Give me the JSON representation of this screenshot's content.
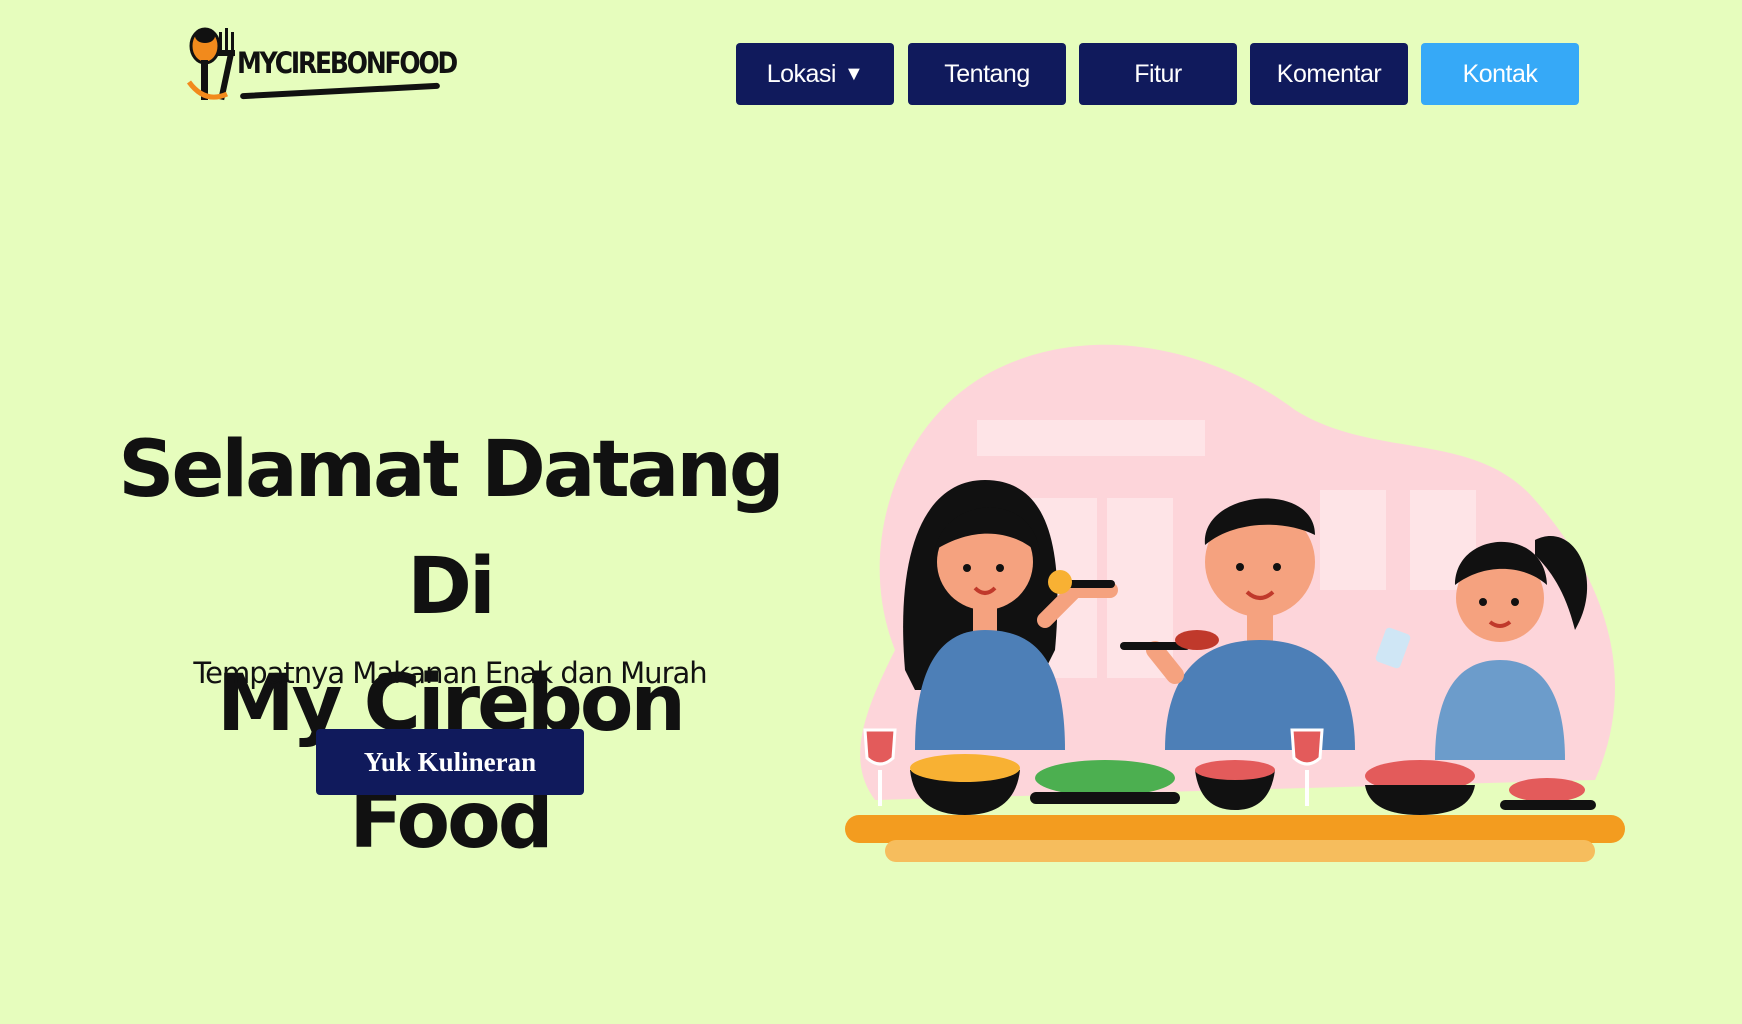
{
  "brand": {
    "logo_text": "MYCIREBONFOOD"
  },
  "nav": {
    "items": [
      {
        "label": "Lokasi",
        "caret": "▼"
      },
      {
        "label": "Tentang"
      },
      {
        "label": "Fitur"
      },
      {
        "label": "Komentar"
      },
      {
        "label": "Kontak"
      }
    ],
    "active_color": "#36a9f7",
    "color": "#101a5c"
  },
  "hero": {
    "title_line1": "Selamat Datang Di",
    "title_line2": "My Cirebon Food",
    "subtitle": "Tempatnya Makanan Enak dan Murah",
    "cta_label": "Yuk Kulineran"
  },
  "colors": {
    "background": "#e6fdbd",
    "accent": "#36a9f7",
    "navy": "#101a5c"
  },
  "illustration": {
    "icon": "family-dining-illustration"
  }
}
